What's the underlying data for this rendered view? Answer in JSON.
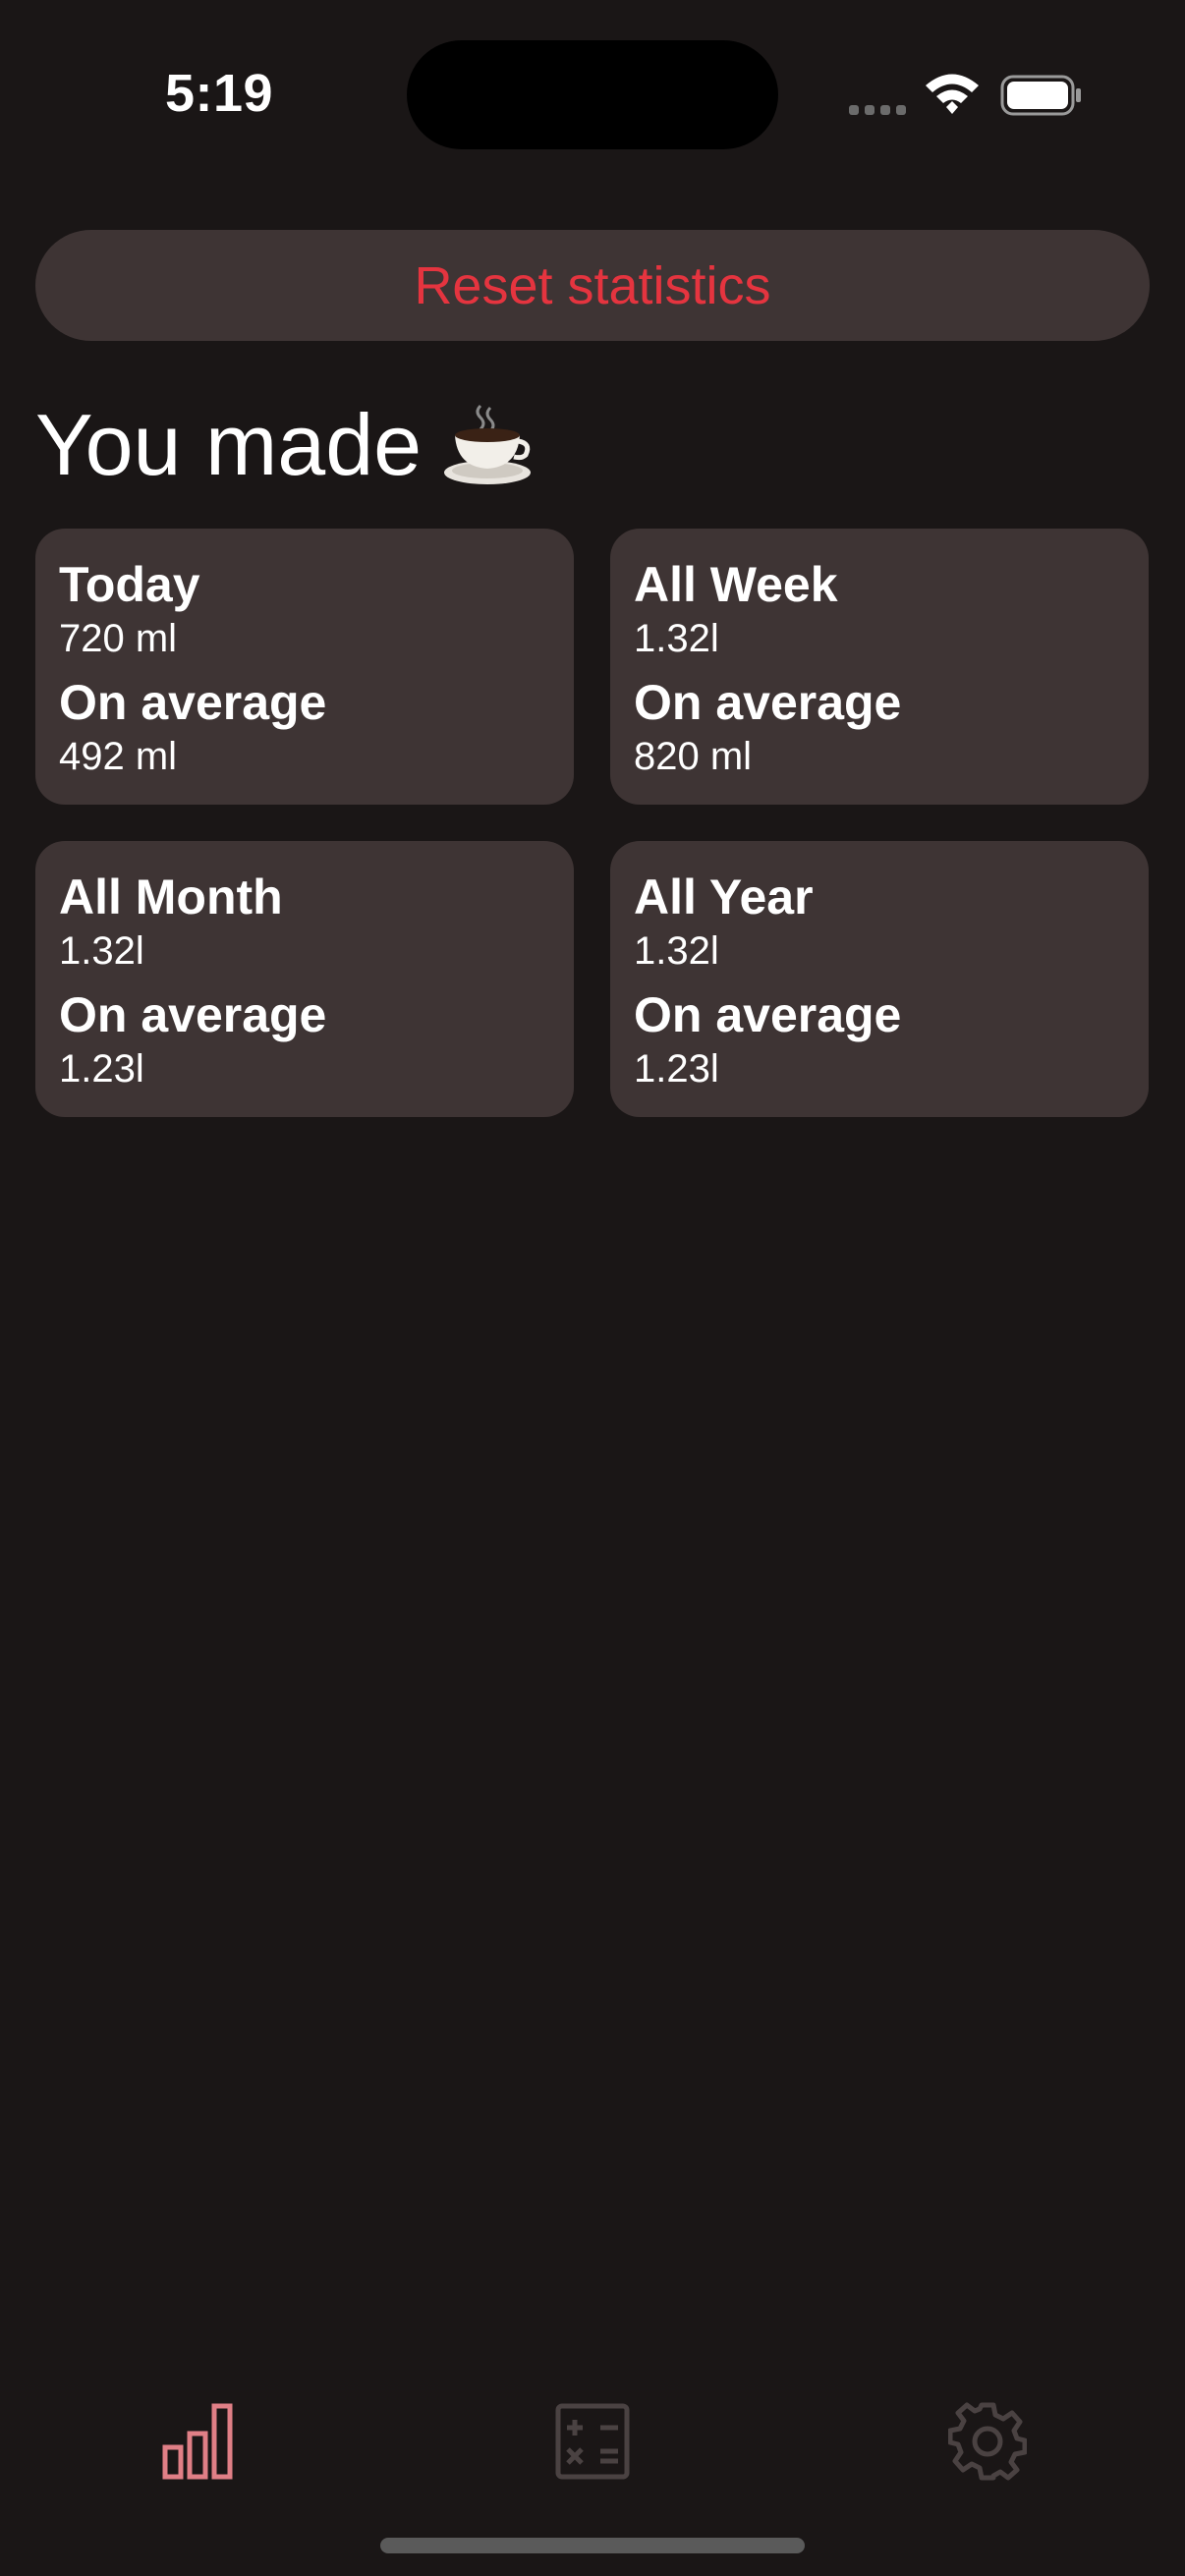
{
  "status_bar": {
    "time": "5:19"
  },
  "reset_button": {
    "label": "Reset statistics",
    "color": "#e5343f"
  },
  "title": {
    "text": "You made",
    "icon": "coffee-cup-icon"
  },
  "cards": [
    {
      "title": "Today",
      "value": "720 ml",
      "avg_label": "On average",
      "avg_value": "492 ml"
    },
    {
      "title": "All Week",
      "value": "1.32l",
      "avg_label": "On average",
      "avg_value": "820 ml"
    },
    {
      "title": "All Month",
      "value": "1.32l",
      "avg_label": "On average",
      "avg_value": "1.23l"
    },
    {
      "title": "All Year",
      "value": "1.32l",
      "avg_label": "On average",
      "avg_value": "1.23l"
    }
  ],
  "tab_bar": {
    "tabs": [
      {
        "icon": "bar-chart-icon",
        "active": true
      },
      {
        "icon": "calculator-icon",
        "active": false
      },
      {
        "icon": "gear-icon",
        "active": false
      }
    ],
    "active_color": "#e07f86",
    "inactive_color": "#4a4242"
  },
  "colors": {
    "background": "#1a1616",
    "card": "#3e3434"
  }
}
